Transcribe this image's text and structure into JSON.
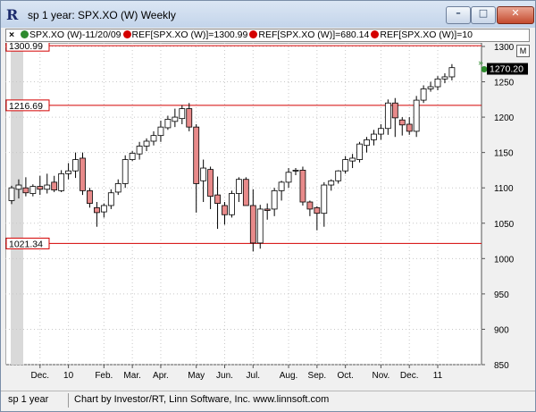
{
  "window": {
    "title": "sp 1 year: SPX.XO (W) Weekly",
    "app_icon": "R",
    "buttons": {
      "minimize": "–",
      "maximize": "□",
      "close": "✕"
    }
  },
  "legend": {
    "close_glyph": "×",
    "items": [
      {
        "text": "SPX.XO (W)-11/20/09",
        "color": "#2e8b2e",
        "icon": "green-dot-icon"
      },
      {
        "text": "REF[SPX.XO (W)]=1300.99",
        "color": "#d40000",
        "icon": "red-dot-icon"
      },
      {
        "text": "REF[SPX.XO (W)]=680.14",
        "color": "#d40000",
        "icon": "red-dot-icon"
      },
      {
        "text": "REF[SPX.XO (W)]=10",
        "color": "#d40000",
        "icon": "red-dot-icon"
      }
    ]
  },
  "m_button": "M",
  "footer": {
    "symbol": "sp 1 year",
    "credit": "Chart by Investor/RT, Linn Software, Inc. www.linnsoft.com"
  },
  "chart_data": {
    "type": "candlestick",
    "ylim": [
      850,
      1305
    ],
    "y_ticks": [
      850,
      900,
      950,
      1000,
      1050,
      1100,
      1150,
      1200,
      1250,
      1300
    ],
    "x_tick_labels": [
      {
        "label": "Dec.",
        "week": 4
      },
      {
        "label": "10",
        "week": 8
      },
      {
        "label": "Feb.",
        "week": 13
      },
      {
        "label": "Mar.",
        "week": 17
      },
      {
        "label": "Apr.",
        "week": 21
      },
      {
        "label": "May",
        "week": 26
      },
      {
        "label": "Jun.",
        "week": 30
      },
      {
        "label": "Jul.",
        "week": 34
      },
      {
        "label": "Aug.",
        "week": 39
      },
      {
        "label": "Sep.",
        "week": 43
      },
      {
        "label": "Oct.",
        "week": 47
      },
      {
        "label": "Nov.",
        "week": 52
      },
      {
        "label": "Dec.",
        "week": 56
      },
      {
        "label": "11",
        "week": 60
      }
    ],
    "ref_lines": [
      {
        "value": 1300.99,
        "label": "1300.99",
        "color": "#d40000"
      },
      {
        "value": 1216.69,
        "label": "1216.69",
        "color": "#d40000"
      },
      {
        "value": 1021.34,
        "label": "1021.34",
        "color": "#d40000"
      }
    ],
    "last_price": {
      "value": 1270.2,
      "label": "1270.20"
    },
    "up_color": "#ffffff",
    "down_color": "#e88a8a",
    "candles": [
      {
        "o": 1082,
        "h": 1103,
        "l": 1077,
        "c": 1100
      },
      {
        "o": 1098,
        "h": 1112,
        "l": 1085,
        "c": 1104
      },
      {
        "o": 1100,
        "h": 1115,
        "l": 1088,
        "c": 1093
      },
      {
        "o": 1092,
        "h": 1105,
        "l": 1088,
        "c": 1102
      },
      {
        "o": 1102,
        "h": 1117,
        "l": 1090,
        "c": 1098
      },
      {
        "o": 1098,
        "h": 1120,
        "l": 1092,
        "c": 1104
      },
      {
        "o": 1108,
        "h": 1117,
        "l": 1094,
        "c": 1097
      },
      {
        "o": 1096,
        "h": 1125,
        "l": 1094,
        "c": 1120
      },
      {
        "o": 1120,
        "h": 1135,
        "l": 1112,
        "c": 1124
      },
      {
        "o": 1124,
        "h": 1150,
        "l": 1114,
        "c": 1140
      },
      {
        "o": 1142,
        "h": 1150,
        "l": 1090,
        "c": 1096
      },
      {
        "o": 1096,
        "h": 1100,
        "l": 1072,
        "c": 1078
      },
      {
        "o": 1072,
        "h": 1080,
        "l": 1045,
        "c": 1065
      },
      {
        "o": 1066,
        "h": 1078,
        "l": 1058,
        "c": 1075
      },
      {
        "o": 1075,
        "h": 1098,
        "l": 1070,
        "c": 1093
      },
      {
        "o": 1094,
        "h": 1112,
        "l": 1090,
        "c": 1106
      },
      {
        "o": 1106,
        "h": 1146,
        "l": 1100,
        "c": 1140
      },
      {
        "o": 1140,
        "h": 1152,
        "l": 1138,
        "c": 1149
      },
      {
        "o": 1148,
        "h": 1165,
        "l": 1140,
        "c": 1159
      },
      {
        "o": 1159,
        "h": 1170,
        "l": 1152,
        "c": 1166
      },
      {
        "o": 1166,
        "h": 1180,
        "l": 1160,
        "c": 1174
      },
      {
        "o": 1174,
        "h": 1195,
        "l": 1165,
        "c": 1186
      },
      {
        "o": 1185,
        "h": 1202,
        "l": 1182,
        "c": 1197
      },
      {
        "o": 1194,
        "h": 1212,
        "l": 1186,
        "c": 1200
      },
      {
        "o": 1198,
        "h": 1217,
        "l": 1190,
        "c": 1212
      },
      {
        "o": 1212,
        "h": 1220,
        "l": 1180,
        "c": 1186
      },
      {
        "o": 1186,
        "h": 1190,
        "l": 1065,
        "c": 1106
      },
      {
        "o": 1110,
        "h": 1140,
        "l": 1080,
        "c": 1128
      },
      {
        "o": 1126,
        "h": 1130,
        "l": 1070,
        "c": 1088
      },
      {
        "o": 1090,
        "h": 1116,
        "l": 1042,
        "c": 1078
      },
      {
        "o": 1075,
        "h": 1080,
        "l": 1048,
        "c": 1062
      },
      {
        "o": 1062,
        "h": 1096,
        "l": 1058,
        "c": 1092
      },
      {
        "o": 1092,
        "h": 1115,
        "l": 1080,
        "c": 1112
      },
      {
        "o": 1112,
        "h": 1115,
        "l": 1078,
        "c": 1075
      },
      {
        "o": 1075,
        "h": 1098,
        "l": 1010,
        "c": 1022
      },
      {
        "o": 1022,
        "h": 1076,
        "l": 1014,
        "c": 1070
      },
      {
        "o": 1070,
        "h": 1078,
        "l": 1055,
        "c": 1068
      },
      {
        "o": 1070,
        "h": 1100,
        "l": 1060,
        "c": 1096
      },
      {
        "o": 1096,
        "h": 1110,
        "l": 1082,
        "c": 1108
      },
      {
        "o": 1108,
        "h": 1128,
        "l": 1100,
        "c": 1122
      },
      {
        "o": 1124,
        "h": 1128,
        "l": 1118,
        "c": 1125
      },
      {
        "o": 1125,
        "h": 1130,
        "l": 1075,
        "c": 1080
      },
      {
        "o": 1080,
        "h": 1082,
        "l": 1060,
        "c": 1070
      },
      {
        "o": 1072,
        "h": 1074,
        "l": 1040,
        "c": 1064
      },
      {
        "o": 1064,
        "h": 1108,
        "l": 1045,
        "c": 1104
      },
      {
        "o": 1104,
        "h": 1112,
        "l": 1096,
        "c": 1110
      },
      {
        "o": 1110,
        "h": 1125,
        "l": 1106,
        "c": 1124
      },
      {
        "o": 1124,
        "h": 1145,
        "l": 1120,
        "c": 1140
      },
      {
        "o": 1138,
        "h": 1148,
        "l": 1128,
        "c": 1142
      },
      {
        "o": 1140,
        "h": 1165,
        "l": 1136,
        "c": 1162
      },
      {
        "o": 1160,
        "h": 1172,
        "l": 1150,
        "c": 1168
      },
      {
        "o": 1168,
        "h": 1182,
        "l": 1160,
        "c": 1176
      },
      {
        "o": 1176,
        "h": 1190,
        "l": 1168,
        "c": 1184
      },
      {
        "o": 1184,
        "h": 1225,
        "l": 1175,
        "c": 1220
      },
      {
        "o": 1220,
        "h": 1227,
        "l": 1172,
        "c": 1199
      },
      {
        "o": 1196,
        "h": 1200,
        "l": 1174,
        "c": 1189
      },
      {
        "o": 1190,
        "h": 1200,
        "l": 1175,
        "c": 1180
      },
      {
        "o": 1180,
        "h": 1230,
        "l": 1172,
        "c": 1224
      },
      {
        "o": 1224,
        "h": 1245,
        "l": 1220,
        "c": 1240
      },
      {
        "o": 1240,
        "h": 1250,
        "l": 1236,
        "c": 1243
      },
      {
        "o": 1243,
        "h": 1258,
        "l": 1238,
        "c": 1254
      },
      {
        "o": 1254,
        "h": 1262,
        "l": 1248,
        "c": 1257
      },
      {
        "o": 1257,
        "h": 1275,
        "l": 1252,
        "c": 1270
      }
    ]
  }
}
